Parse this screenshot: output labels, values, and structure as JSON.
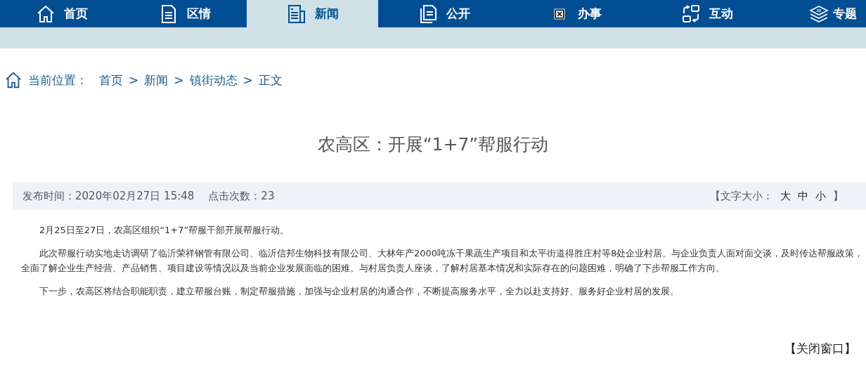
{
  "nav": {
    "tabs": [
      {
        "label": "首页",
        "kind": "house",
        "selected": false
      },
      {
        "label": "区情",
        "kind": "document",
        "selected": false
      },
      {
        "label": "新闻",
        "kind": "newspaper",
        "selected": true
      },
      {
        "label": "公开",
        "kind": "copies",
        "selected": false
      },
      {
        "label": "办事",
        "kind": "broken",
        "selected": false
      },
      {
        "label": "互动",
        "kind": "exchange",
        "selected": false
      },
      {
        "label": "专题",
        "kind": "layers",
        "selected": false
      }
    ]
  },
  "breadcrumb": {
    "label": "当前位置：",
    "items": [
      "首页",
      "新闻",
      "镇街动态",
      "正文"
    ],
    "separator": ">"
  },
  "article": {
    "title": "农高区：开展“1+7”帮服行动",
    "meta": {
      "publish_time": "发布时间：2020年02月27日 15:48",
      "clicks": "点击次数：23",
      "font_size_open": "【文字大小：",
      "font_sizes": [
        "大",
        "中",
        "小"
      ],
      "font_size_close": "】"
    },
    "paragraphs": [
      "2月25日至27日，农高区组织“1+7”帮服干部开展帮服行动。",
      "此次帮服行动实地走访调研了临沂荣祥钢管有限公司、临沂信邦生物科技有限公司、大林年产2000吨冻干果蔬生产项目和太平街道得胜庄村等8处企业村居。与企业负责人面对面交谈，及时传达帮服政策，全面了解企业生产经营、产品销售、项目建设等情况以及当前企业发展面临的困难。与村居负责人座谈，了解村居基本情况和实际存在的问题困难，明确了下步帮服工作方向。",
      "下一步，农高区将结合职能职责，建立帮服台账，制定帮服措施，加强与企业村居的沟通合作，不断提高服务水平，全力以赴支持好、服务好企业村居的发展。"
    ],
    "close": "【关闭窗口】"
  }
}
